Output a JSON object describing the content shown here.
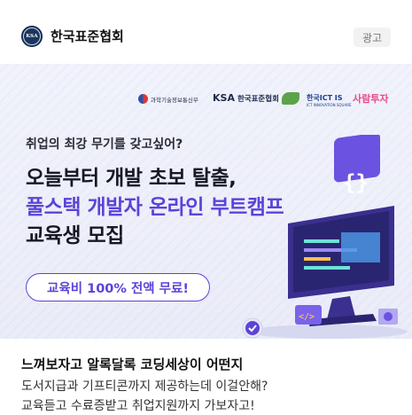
{
  "header": {
    "avatar_text": "KSA",
    "publisher": "한국표준협회",
    "ad_label": "광고"
  },
  "banner": {
    "logos": {
      "msit": "과학기술정보통신부",
      "ksa_main": "KSA",
      "ksa_sub": "한국표준협회",
      "ict_main": "한국ICT IS",
      "ict_sub": "ICT INNOVATION SQUARE",
      "people": "사람투자"
    },
    "tagline": "취업의 최강 무기를 갖고싶어?",
    "title_line1": "오늘부터 개발 초보 탈출,",
    "title_line2": "풀스택 개발자 온라인 부트캠프",
    "title_line3": "교육생 모집",
    "free_pill": "교육비 100% 전액 무료!"
  },
  "content": {
    "headline": "느껴보자고 알록달록 코딩세상이 어떤지",
    "description_line1": "도서지급과 기프티콘까지 제공하는데 이걸안해?",
    "description_line2": "교육듣고 수료증받고 취업지원까지 가보자고!"
  },
  "colors": {
    "accent": "#5b43d8",
    "ad_badge_bg": "#f2f2f2",
    "banner_bg": "#eef0fb"
  }
}
